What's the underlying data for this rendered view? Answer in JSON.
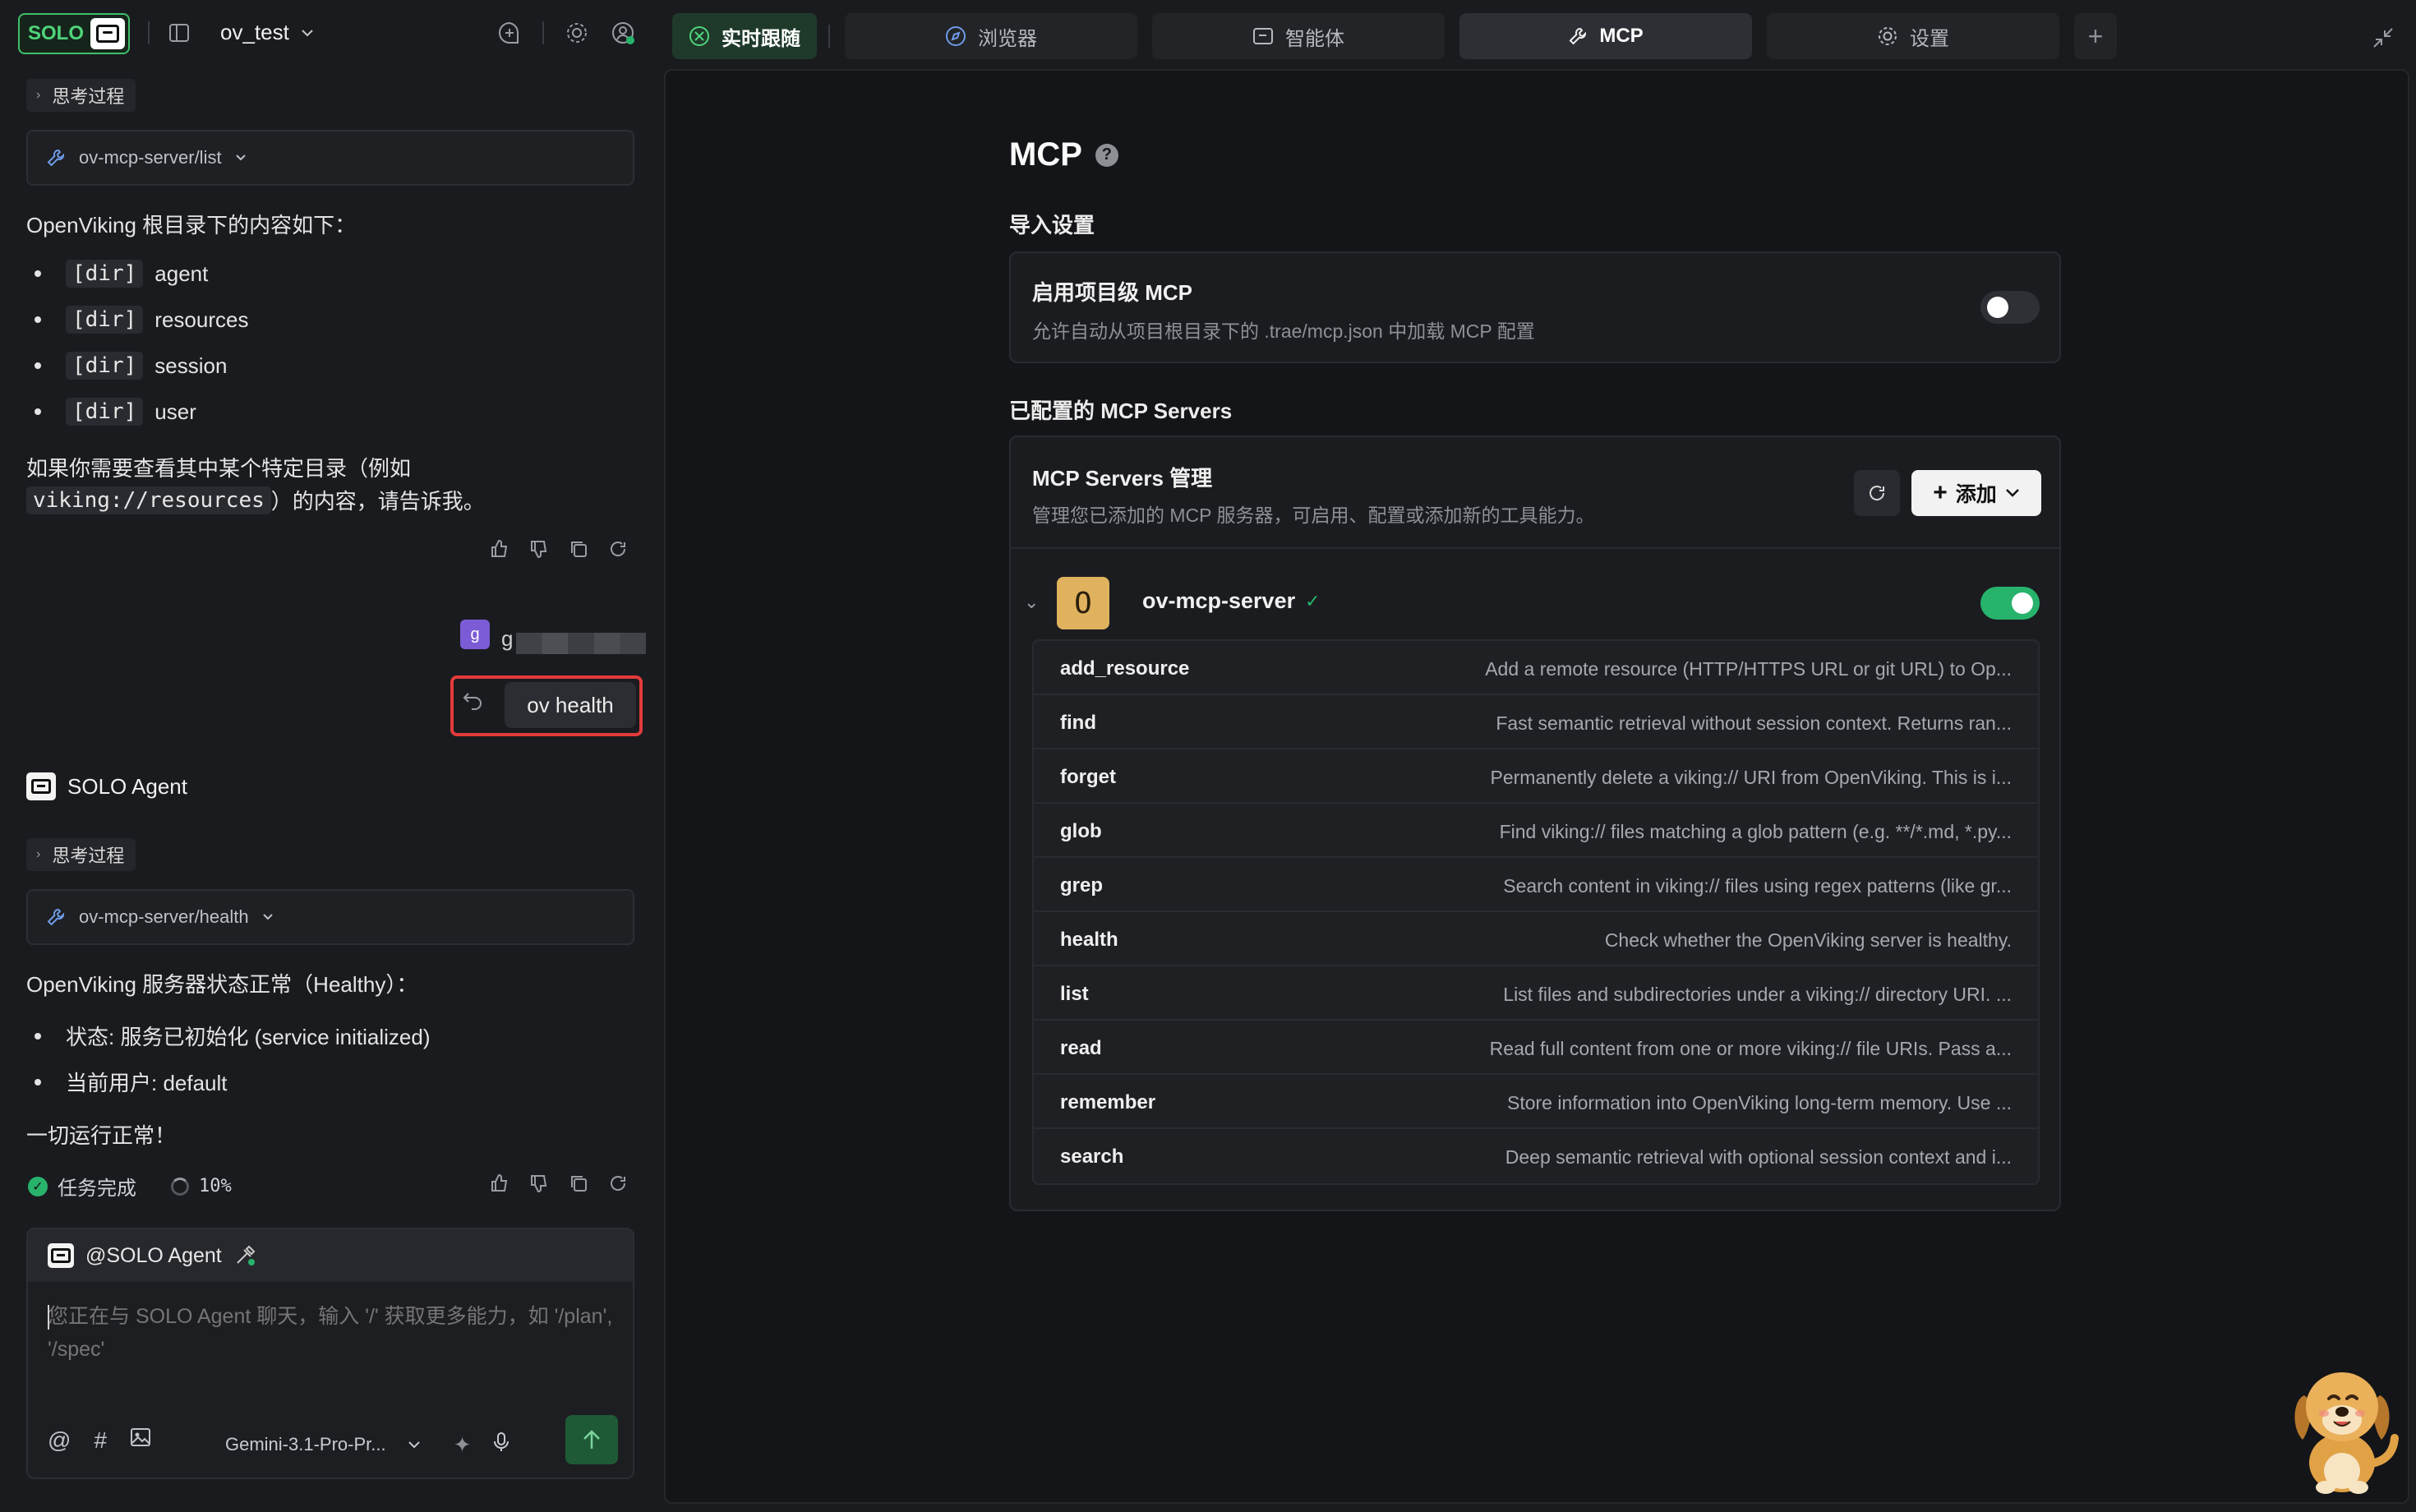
{
  "app": {
    "logo_text": "SOLO",
    "project_name": "ov_test"
  },
  "chat": {
    "thinking_label_1": "思考过程",
    "tool_call_1": "ov-mcp-server/list",
    "reply_1_intro": "OpenViking 根目录下的内容如下：",
    "reply_1_items": [
      {
        "tag": "[dir]",
        "name": "agent"
      },
      {
        "tag": "[dir]",
        "name": "resources"
      },
      {
        "tag": "[dir]",
        "name": "session"
      },
      {
        "tag": "[dir]",
        "name": "user"
      }
    ],
    "reply_1_outro_a": "如果你需要查看其中某个特定目录（例如",
    "reply_1_outro_code": "viking://resources",
    "reply_1_outro_b": "）的内容，请告诉我。",
    "user_avatar_letter": "g",
    "user_name_partial": "g",
    "user_message": "ov health",
    "agent_name": "SOLO Agent",
    "thinking_label_2": "思考过程",
    "tool_call_2": "ov-mcp-server/health",
    "reply_2_intro": "OpenViking 服务器状态正常（Healthy）：",
    "reply_2_items": [
      "状态: 服务已初始化 (service initialized)",
      "当前用户: default"
    ],
    "reply_2_outro": "一切运行正常！",
    "status_done": "任务完成",
    "progress": "10%",
    "input_mention": "@SOLO Agent",
    "input_placeholder": "您正在与 SOLO Agent 聊天，输入 '/' 获取更多能力，如 '/plan', '/spec'",
    "model": "Gemini-3.1-Pro-Pr..."
  },
  "tabs": [
    {
      "label": "实时跟随",
      "icon": "follow-icon"
    },
    {
      "label": "浏览器",
      "icon": "compass-icon"
    },
    {
      "label": "智能体",
      "icon": "agent-icon"
    },
    {
      "label": "MCP",
      "icon": "wrench-icon"
    },
    {
      "label": "设置",
      "icon": "gear-icon"
    }
  ],
  "mcp": {
    "title": "MCP",
    "import_section": "导入设置",
    "project_mcp_title": "启用项目级 MCP",
    "project_mcp_desc": "允许自动从项目根目录下的 .trae/mcp.json 中加载 MCP 配置",
    "project_mcp_enabled": false,
    "configured_section": "已配置的 MCP Servers",
    "manage_title": "MCP Servers 管理",
    "manage_desc": "管理您已添加的 MCP 服务器，可启用、配置或添加新的工具能力。",
    "add_label": "添加",
    "server": {
      "badge": "O",
      "name": "ov-mcp-server",
      "enabled": true,
      "tools": [
        {
          "name": "add_resource",
          "desc": "Add a remote resource (HTTP/HTTPS URL or git URL) to Op..."
        },
        {
          "name": "find",
          "desc": "Fast semantic retrieval without session context. Returns ran..."
        },
        {
          "name": "forget",
          "desc": "Permanently delete a viking:// URI from OpenViking. This is i..."
        },
        {
          "name": "glob",
          "desc": "Find viking:// files matching a glob pattern (e.g. **/*.md, *.py..."
        },
        {
          "name": "grep",
          "desc": "Search content in viking:// files using regex patterns (like gr..."
        },
        {
          "name": "health",
          "desc": "Check whether the OpenViking server is healthy."
        },
        {
          "name": "list",
          "desc": "List files and subdirectories under a viking:// directory URI. ..."
        },
        {
          "name": "read",
          "desc": "Read full content from one or more viking:// file URIs. Pass a..."
        },
        {
          "name": "remember",
          "desc": "Store information into OpenViking long-term memory. Use ..."
        },
        {
          "name": "search",
          "desc": "Deep semantic retrieval with optional session context and i..."
        }
      ]
    }
  },
  "colors": {
    "accent_green": "#27b36b",
    "highlight_red": "#e23b3b",
    "badge_gold": "#e0b25e"
  }
}
